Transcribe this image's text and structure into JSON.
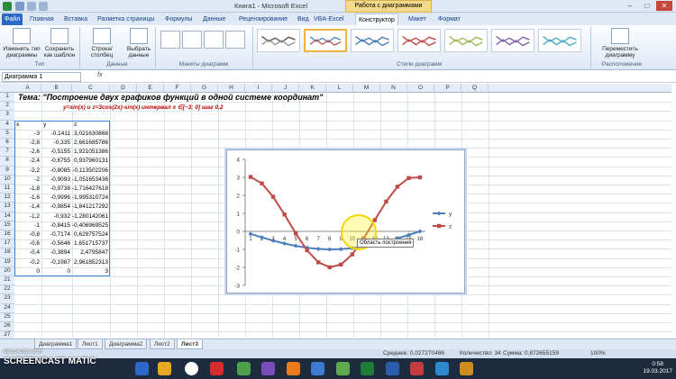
{
  "window": {
    "title": "Книга1 - Microsoft Excel",
    "context_tab": "Работа с диаграммами",
    "minimize": "–",
    "maximize": "□",
    "close": "✕"
  },
  "ribbon_tabs": [
    "Файл",
    "Главная",
    "Вставка",
    "Разметка страницы",
    "Формулы",
    "Данные",
    "Рецензирование",
    "Вид",
    "VBA-Excel",
    "Конструктор",
    "Макет",
    "Формат"
  ],
  "ribbon": {
    "change_type": "Изменить тип диаграммы",
    "save_template": "Сохранить как шаблон",
    "row_column": "Строка/столбец",
    "select_data": "Выбрать данные",
    "move_chart": "Переместить диаграмму",
    "groups": {
      "type": "Тип",
      "data": "Данные",
      "layouts": "Макеты диаграмм",
      "styles": "Стили диаграмм",
      "location": "Расположение"
    }
  },
  "formula_bar": {
    "name_box": "Диаграмма 1",
    "fx": "fx"
  },
  "columns": [
    "A",
    "B",
    "C",
    "D",
    "E",
    "F",
    "G",
    "H",
    "I",
    "J",
    "K",
    "L",
    "M",
    "N",
    "O",
    "P",
    "Q"
  ],
  "rows": [
    "1",
    "2",
    "3",
    "4",
    "5",
    "6",
    "7",
    "8",
    "9",
    "10",
    "11",
    "12",
    "13",
    "14",
    "15",
    "16",
    "17",
    "18",
    "19",
    "20",
    "21",
    "22",
    "23",
    "24",
    "25",
    "26",
    "27"
  ],
  "sheet": {
    "title": "Тема: \"Построение двух графиков функций в одной системе координат\"",
    "subtitle": "y=sin(x) и z=3cos(2x)-sin(x) интервал x ∈[−3; 0] шаг 0,2",
    "headers": [
      "x",
      "y",
      "z"
    ],
    "data_rows": [
      [
        "-3",
        "-0,1411",
        "3,021630868"
      ],
      [
        "-2,8",
        "-0,335",
        "2,661685786"
      ],
      [
        "-2,6",
        "-0,5155",
        "1,921051386"
      ],
      [
        "-2,4",
        "-0,6755",
        "0,937960131"
      ],
      [
        "-2,2",
        "-0,8085",
        "-0,113502206"
      ],
      [
        "-2",
        "-0,9093",
        "-1,051653436"
      ],
      [
        "-1,8",
        "-0,9738",
        "-1,716427618"
      ],
      [
        "-1,6",
        "-0,9996",
        "-1,995310724"
      ],
      [
        "-1,4",
        "-0,9854",
        "-1,841217292"
      ],
      [
        "-1,2",
        "-0,932",
        "-1,280142061"
      ],
      [
        "-1",
        "-0,8415",
        "-0,406969525"
      ],
      [
        "-0,8",
        "-0,7174",
        "0,629757524"
      ],
      [
        "-0,6",
        "-0,5646",
        "1,651715737"
      ],
      [
        "-0,4",
        "-0,3894",
        "2,4795847"
      ],
      [
        "-0,2",
        "-0,1987",
        "2,961852313"
      ],
      [
        "0",
        "0",
        "3"
      ]
    ]
  },
  "chart_data": {
    "type": "line",
    "categories": [
      "1",
      "2",
      "3",
      "4",
      "5",
      "6",
      "7",
      "8",
      "9",
      "10",
      "11",
      "12",
      "13",
      "14",
      "15",
      "16"
    ],
    "series": [
      {
        "name": "y",
        "color": "#4a7ebb",
        "values": [
          -0.1411,
          -0.335,
          -0.5155,
          -0.6755,
          -0.8085,
          -0.9093,
          -0.9738,
          -0.9996,
          -0.9854,
          -0.932,
          -0.8415,
          -0.7174,
          -0.5646,
          -0.3894,
          -0.1987,
          0
        ]
      },
      {
        "name": "z",
        "color": "#be4b48",
        "values": [
          3.0216,
          2.6617,
          1.9211,
          0.938,
          -0.1135,
          -1.0517,
          -1.7164,
          -1.9953,
          -1.8412,
          -1.2801,
          -0.407,
          0.6298,
          1.6517,
          2.4796,
          2.9619,
          3
        ]
      }
    ],
    "ylim": [
      -3,
      4
    ],
    "yticks": [
      "4",
      "3",
      "2",
      "1",
      "0",
      "-1",
      "-2",
      "-3"
    ],
    "legend": "right",
    "tooltip": "Область построения"
  },
  "sheet_tabs": [
    "Диаграмма1",
    "Лист1",
    "Диаграмма2",
    "Лист2",
    "Лист3"
  ],
  "active_sheet": "Лист3",
  "status": {
    "average": "Среднее: 0,027270486",
    "count": "Количество: 34",
    "sum": "Сумма: 0,872655159",
    "zoom": "100%"
  },
  "taskbar": {
    "time": "0:58",
    "date": "19.03.2017"
  },
  "watermark": {
    "top": "RECORDED WITH",
    "main": "SCREENCAST  MATIC"
  }
}
